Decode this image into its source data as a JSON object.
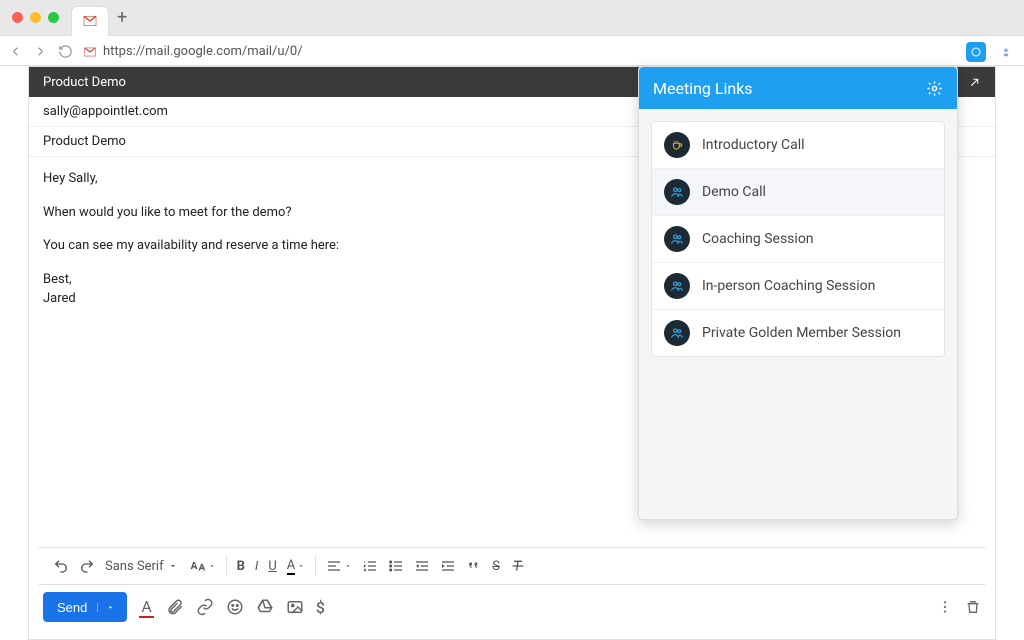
{
  "browser": {
    "url": "https://mail.google.com/mail/u/0/"
  },
  "compose": {
    "title": "Product Demo",
    "to": "sally@appointlet.com",
    "subject": "Product Demo",
    "body": {
      "greeting": "Hey Sally,",
      "line1": "When would you like to meet for the demo?",
      "line2": "You can see my availability and reserve a time here:",
      "signoff": "Best,",
      "name": "Jared"
    }
  },
  "toolbar": {
    "font_name": "Sans Serif",
    "send_label": "Send"
  },
  "panel": {
    "title": "Meeting Links",
    "items": [
      {
        "label": "Introductory Call",
        "icon": "cup",
        "selected": false
      },
      {
        "label": "Demo Call",
        "icon": "people",
        "selected": true
      },
      {
        "label": "Coaching Session",
        "icon": "people",
        "selected": false
      },
      {
        "label": "In-person Coaching Session",
        "icon": "people",
        "selected": false
      },
      {
        "label": "Private Golden Member Session",
        "icon": "people",
        "selected": false
      }
    ]
  }
}
